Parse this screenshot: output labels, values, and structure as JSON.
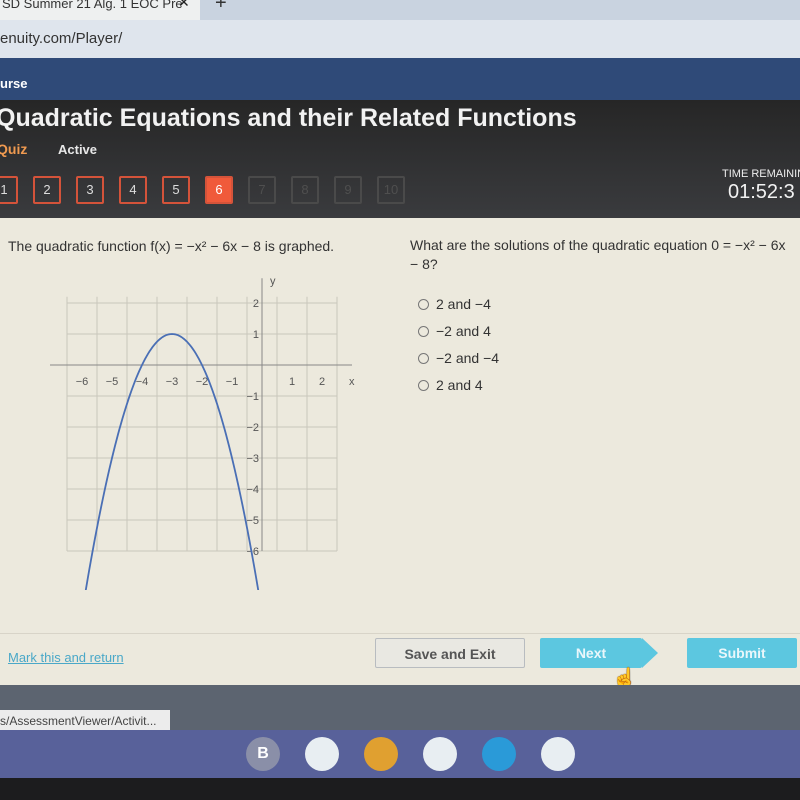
{
  "browser": {
    "tab_title": "SD Summer 21 Alg. 1 EOC Pre",
    "tab_close": "✕",
    "new_tab": "+",
    "url": "enuity.com/Player/",
    "status_url": "s/AssessmentViewer/Activit..."
  },
  "header": {
    "breadcrumb": "urse",
    "title": "Quadratic Equations and their Related Functions",
    "type": "Quiz",
    "status": "Active",
    "questions": [
      {
        "n": "1",
        "state": "done"
      },
      {
        "n": "2",
        "state": "done"
      },
      {
        "n": "3",
        "state": "done"
      },
      {
        "n": "4",
        "state": "done"
      },
      {
        "n": "5",
        "state": "done"
      },
      {
        "n": "6",
        "state": "current"
      },
      {
        "n": "7",
        "state": "disabled"
      },
      {
        "n": "8",
        "state": "disabled"
      },
      {
        "n": "9",
        "state": "disabled"
      },
      {
        "n": "10",
        "state": "disabled"
      }
    ],
    "time_label": "TIME REMAINING",
    "time_value": "01:52:3"
  },
  "question": {
    "prompt": "The quadratic function f(x) = −x² − 6x − 8 is graphed.",
    "text": "What are the solutions of the quadratic equation 0 = −x² − 6x − 8?",
    "options": [
      "2 and −4",
      "−2 and 4",
      "−2 and −4",
      "2 and 4"
    ]
  },
  "graph": {
    "function": "-x^2-6x-8",
    "x_label": "x",
    "y_label": "y",
    "xlim": [
      -6.5,
      2.5
    ],
    "ylim": [
      -6,
      2.2
    ],
    "x_ticks": [
      "−6",
      "−5",
      "−4",
      "−3",
      "−2",
      "−1",
      "1",
      "2"
    ],
    "y_ticks": [
      "2",
      "1",
      "−1",
      "−2",
      "−3",
      "−4",
      "−5",
      "−6"
    ],
    "curve_color": "#4a6fb5"
  },
  "footer": {
    "mark_link": "Mark this and return",
    "save_exit": "Save and Exit",
    "next": "Next",
    "submit": "Submit"
  },
  "shelf": {
    "apps": [
      {
        "name": "account",
        "label": "B",
        "color": "#8a8fa8"
      },
      {
        "name": "app",
        "label": "",
        "color": "#e8eef2"
      },
      {
        "name": "chrome",
        "label": "",
        "color": "#e0a030"
      },
      {
        "name": "docs",
        "label": "",
        "color": "#e8eef2"
      },
      {
        "name": "camera",
        "label": "",
        "color": "#2a9ad8"
      },
      {
        "name": "play-store",
        "label": "",
        "color": "#e8eef2"
      }
    ]
  }
}
